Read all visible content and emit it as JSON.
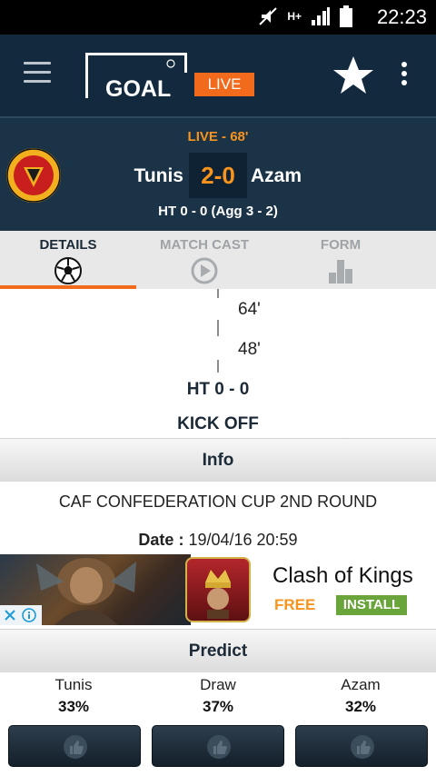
{
  "status_bar": {
    "time": "22:23",
    "network_label": "H+",
    "icons": [
      "mute-icon",
      "signal-icon",
      "battery-icon"
    ]
  },
  "app_bar": {
    "logo_text": "GOAL",
    "live_label": "LIVE",
    "icons": [
      "menu-icon",
      "star-icon",
      "overflow-icon"
    ]
  },
  "match": {
    "live_minute": "LIVE - 68'",
    "home_team": "Tunis",
    "away_team": "Azam",
    "score": "2-0",
    "ht_line": "HT 0 - 0  (Agg 3 - 2)"
  },
  "tabs": [
    {
      "label": "DETAILS",
      "icon": "soccer-ball-icon",
      "active": true
    },
    {
      "label": "MATCH CAST",
      "icon": "play-circle-icon",
      "active": false
    },
    {
      "label": "FORM",
      "icon": "bar-chart-icon",
      "active": false
    }
  ],
  "timeline": {
    "events": [
      "64'",
      "48'"
    ],
    "half_time": "HT 0 - 0",
    "kick_off": "KICK OFF"
  },
  "info": {
    "header": "Info",
    "competition": "CAF CONFEDERATION CUP 2ND ROUND",
    "date_label": "Date :",
    "date_value": "19/04/16 20:59"
  },
  "ad": {
    "title": "Clash of Kings",
    "price": "FREE",
    "cta": "INSTALL"
  },
  "predict": {
    "header": "Predict",
    "options": [
      {
        "label": "Tunis",
        "pct": "33%"
      },
      {
        "label": "Draw",
        "pct": "37%"
      },
      {
        "label": "Azam",
        "pct": "32%"
      }
    ]
  },
  "colors": {
    "app_bar": "#13293d",
    "header": "#1b3347",
    "accent": "#f26b1d",
    "score": "#f7941d",
    "ad_install": "#69a53a"
  }
}
